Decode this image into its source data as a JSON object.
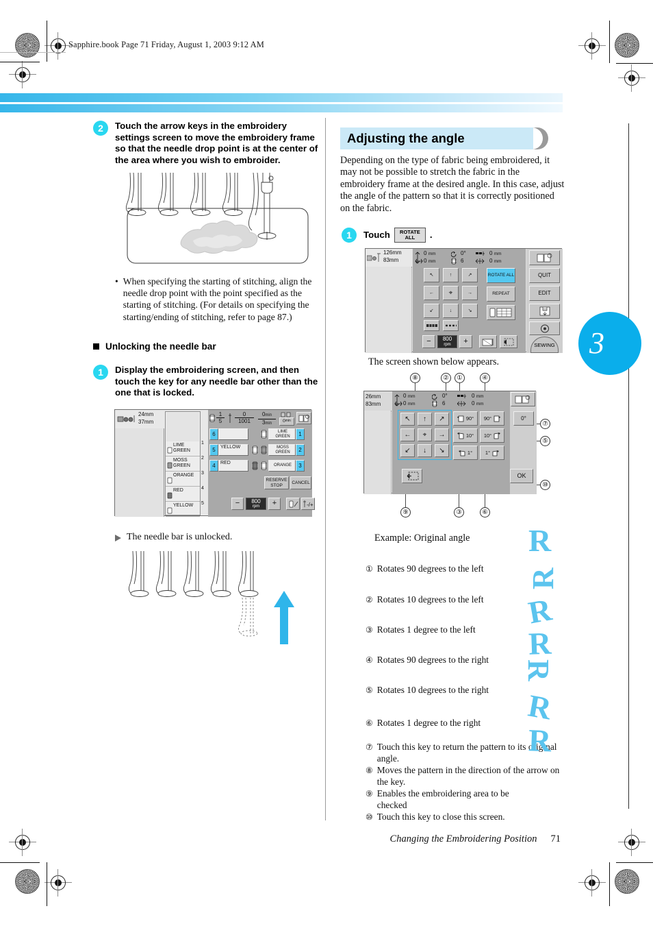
{
  "page": {
    "header_line": "Sapphire.book  Page 71  Friday, August 1, 2003  9:12 AM",
    "chapter_marker": "3",
    "footer_title": "Changing the Embroidering Position",
    "footer_page": "71"
  },
  "left_column": {
    "step2": {
      "number": "2",
      "text": "Touch the arrow keys in the embroidery settings screen to move the embroidery frame so that the needle drop point is at the center of the area where you wish to embroider."
    },
    "bullet": "When specifying the starting of stitching, align the needle drop point with the point specified as the starting of stitching. (For details on specifying the starting/ending of stitching, refer to page 87.)",
    "sub_heading": "Unlocking the needle bar",
    "step1": {
      "number": "1",
      "text": "Display the embroidering screen, and then touch the key for any needle bar other than the one that is locked."
    },
    "result_note": "The needle bar is unlocked.",
    "embroidering_screen": {
      "size_height": "24mm",
      "size_width": "37mm",
      "counter_current": "1",
      "counter_total": "5",
      "stitch_count": "0",
      "stitch_total": "1001",
      "time_elapsed": "0",
      "time_elapsed_unit": "min",
      "time_total": "3",
      "time_total_unit": "min",
      "frame_time": "0",
      "frame_time_unit": "min",
      "thread_list": [
        {
          "index": "1",
          "name": "LIME GREEN"
        },
        {
          "index": "2",
          "name": "MOSS GREEN"
        },
        {
          "index": "3",
          "name": "ORANGE"
        },
        {
          "index": "4",
          "name": "RED"
        },
        {
          "index": "5",
          "name": "YELLOW"
        }
      ],
      "needle_bars": [
        {
          "bar": "6",
          "color": ""
        },
        {
          "bar": "5",
          "color": "YELLOW"
        },
        {
          "bar": "4",
          "color": "RED"
        }
      ],
      "spool_assign": [
        {
          "name": "LIME GREEN",
          "num": "1"
        },
        {
          "name": "MOSS GREEN",
          "num": "2"
        },
        {
          "name": "ORANGE",
          "num": "3"
        }
      ],
      "reserve_stop": "RESERVE STOP",
      "cancel": "CANCEL",
      "speed_value": "800",
      "speed_unit": "rpm",
      "minus": "−",
      "plus": "+"
    }
  },
  "right_column": {
    "section_title": "Adjusting the angle",
    "intro": "Depending on the type of fabric being embroidered, it may not be possible to stretch the fabric in the embroidery frame at the desired angle. In this case, adjust the angle of the pattern so that it is correctly positioned on the fabric.",
    "step1": {
      "number": "1",
      "prefix": "Touch",
      "key_label": "ROTATE ALL",
      "suffix": "."
    },
    "after_step_note": "The screen shown below appears.",
    "screen_a": {
      "size_height": "126mm",
      "size_width": "83mm",
      "offset_v": "0",
      "offset_v_unit": "mm",
      "offset_h": "0",
      "offset_h_unit": "mm",
      "angle": "0°",
      "needle": "6",
      "spacing_v": "0",
      "spacing_v_unit": "mm",
      "spacing_h": "0",
      "spacing_h_unit": "mm",
      "rotate_all": "ROTATE ALL",
      "repeat": "REPEAT",
      "speed_value": "800",
      "speed_unit": "rpm",
      "minus": "−",
      "plus": "+",
      "side_keys": [
        "QUIT",
        "EDIT",
        "SEWING"
      ]
    },
    "screen_b": {
      "size_height": "26mm",
      "size_width": "83mm",
      "offset_v": "0",
      "offset_v_unit": "mm",
      "offset_h": "0",
      "offset_h_unit": "mm",
      "angle": "0°",
      "needle": "6",
      "spacing_v": "0",
      "spacing_v_unit": "mm",
      "spacing_h": "0",
      "spacing_h_unit": "mm",
      "rot_left_90": "90°",
      "rot_right_90": "90°",
      "rot_left_10": "10°",
      "rot_right_10": "10°",
      "rot_left_1": "1°",
      "rot_right_1": "1°",
      "reset": "0°",
      "ok": "OK",
      "callouts": [
        "①",
        "②",
        "③",
        "④",
        "⑤",
        "⑥",
        "⑦",
        "⑧",
        "⑨",
        "⑩"
      ]
    },
    "example_caption": "Example: Original angle",
    "legend": [
      {
        "num": "①",
        "text": "Rotates 90 degrees to the left"
      },
      {
        "num": "②",
        "text": "Rotates 10 degrees to the left"
      },
      {
        "num": "③",
        "text": "Rotates 1 degree to the left"
      },
      {
        "num": "④",
        "text": "Rotates 90 degrees to the right"
      },
      {
        "num": "⑤",
        "text": "Rotates 10 degrees to the right"
      },
      {
        "num": "⑥",
        "text": "Rotates 1 degree to the right"
      },
      {
        "num": "⑦",
        "text": "Touch this key to return the pattern to its original angle."
      },
      {
        "num": "⑧",
        "text": "Moves the pattern in the direction of the arrow on the key."
      },
      {
        "num": "⑨",
        "text": "Enables the embroidering area to be checked"
      },
      {
        "num": "⑩",
        "text": "Touch this key to close this screen."
      }
    ],
    "sample_letter": "R"
  },
  "colors": {
    "accent_blue": "#0aaeeb",
    "step_circle": "#29d7f0",
    "banner": "#cbe9f7",
    "lcd_key_active": "#54c8f0"
  }
}
